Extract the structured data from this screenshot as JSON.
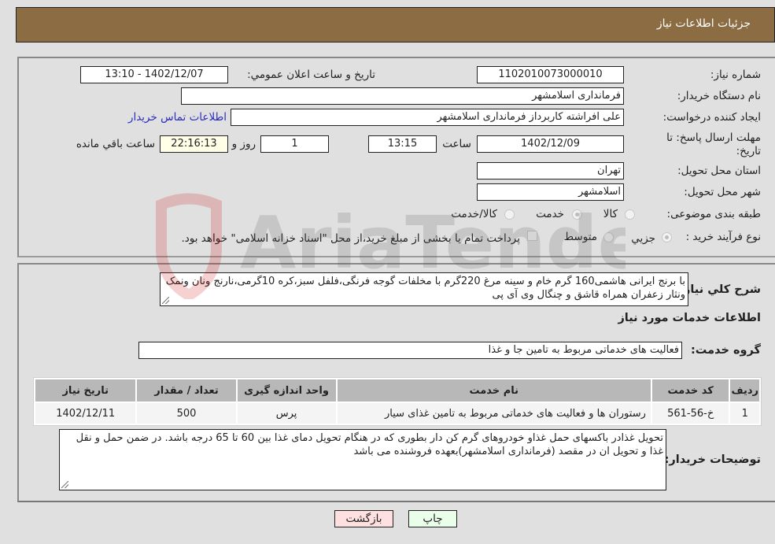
{
  "header": {
    "title": "جزئیات اطلاعات نیاز"
  },
  "form": {
    "need_number_label": "شماره نیاز:",
    "need_number": "1102010073000010",
    "announce_label": "تاريخ و ساعت اعلان عمومي:",
    "announce_value": "1402/12/07 - 13:10",
    "buyer_org_label": "نام دستگاه خریدار:",
    "buyer_org": "فرمانداری اسلامشهر",
    "creator_label": "ایجاد کننده درخواست:",
    "creator": "علی افراشته کاربرداز فرمانداری اسلامشهر",
    "contact_link": "اطلاعات تماس خریدار",
    "deadline_label": "مهلت ارسال پاسخ: تا تاریخ:",
    "deadline_date": "1402/12/09",
    "time_label": "ساعت",
    "deadline_time": "13:15",
    "days_value": "1",
    "days_label": "روز و",
    "remaining_time": "22:16:13",
    "remaining_label": "ساعت باقي مانده",
    "province_label": "استان محل تحویل:",
    "province": "تهران",
    "city_label": "شهر محل تحویل:",
    "city": "اسلامشهر",
    "category_label": "طبقه بندی موضوعی:",
    "category_options": [
      {
        "label": "کالا",
        "selected": false
      },
      {
        "label": "خدمت",
        "selected": true
      },
      {
        "label": "کالا/خدمت",
        "selected": false
      }
    ],
    "process_label": "نوع فرآیند خرید :",
    "process_options": [
      {
        "label": "جزيي",
        "selected": true
      },
      {
        "label": "متوسط",
        "selected": false
      }
    ],
    "treasury_checkbox_label": "پرداخت تمام یا بخشی از مبلغ خرید،از محل \"اسناد خزانه اسلامی\" خواهد بود.",
    "treasury_checked": false
  },
  "details": {
    "summary_label": "شرح کلي نياز:",
    "summary": "با برنج ایرانی هاشمی160 گرم خام و سینه مرغ 220گرم با مخلفات گوجه فرنگی،فلفل سبز،کره 10گرمی،نارنج ونان ونمک ونثار زعفران همراه قاشق و چنگال وی آی پی",
    "services_title": "اطلاعات خدمات مورد نیاز",
    "group_label": "گروه خدمت:",
    "group_value": "فعالیت های خدماتی مربوط به تامین جا و غذا",
    "table": {
      "headers": [
        "ردیف",
        "کد خدمت",
        "نام خدمت",
        "واحد اندازه گیری",
        "تعداد / مقدار",
        "تاریخ نیاز"
      ],
      "rows": [
        {
          "row": "1",
          "code": "خ-56-561",
          "name": "رستوران ها و فعالیت های خدماتی مربوط به تامین غذای سیار",
          "unit": "پرس",
          "qty": "500",
          "date": "1402/12/11"
        }
      ]
    },
    "buyer_notes_label": "توضیحات خریدار:",
    "buyer_notes": "تحویل غذادر باکسهای حمل غذاو خودروهای گرم کن دار بطوری که در هنگام تحویل دمای غذا بین 60 تا 65 درجه باشد. در ضمن حمل و نقل غذا و تحویل ان در مقصد (فرمانداری اسلامشهر)بعهده فروشنده می باشد"
  },
  "buttons": {
    "print": "چاپ",
    "back": "بازگشت"
  },
  "colors": {
    "header_bg": "#8c6c42",
    "print_bg": "#eaffea",
    "back_bg": "#ffe0e0",
    "link": "#2b2bbf"
  },
  "watermark": {
    "text": "AriaTender.neT"
  }
}
